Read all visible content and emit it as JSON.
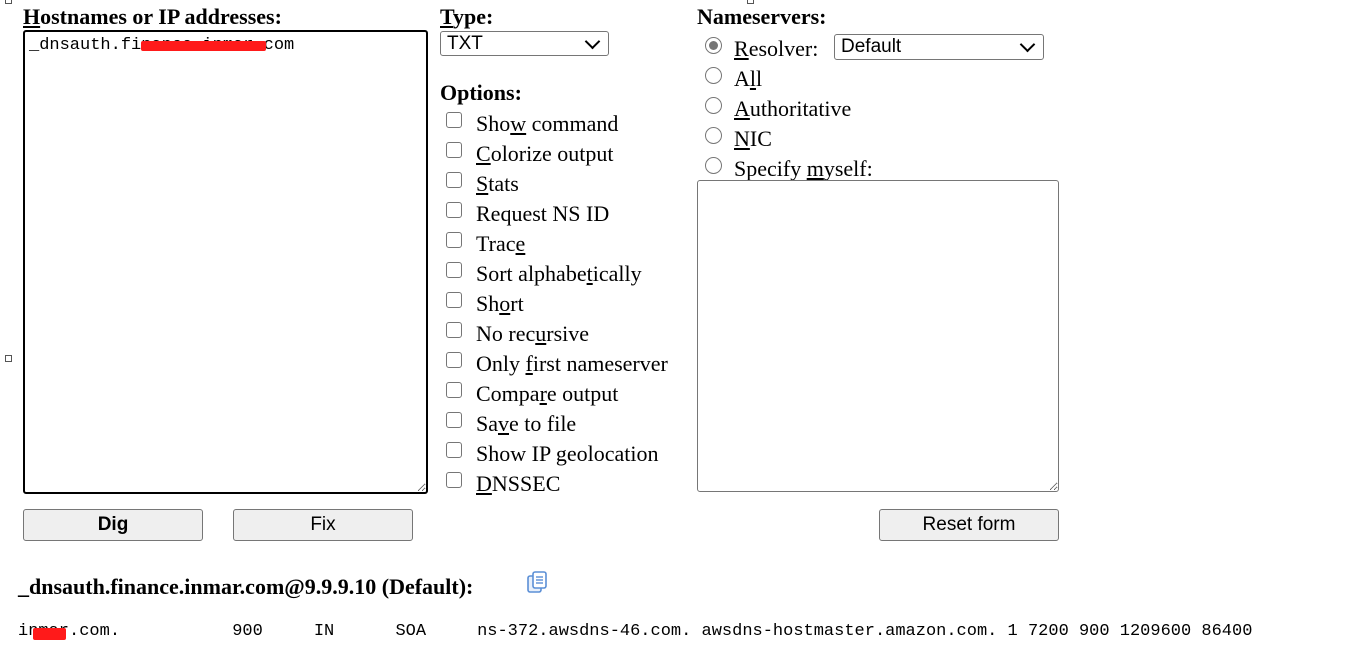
{
  "form": {
    "hostnames_label_first": "H",
    "hostnames_label_rest": "ostnames or IP addresses:",
    "hostnames_value": "_dnsauth.finance.inmar.com",
    "type_label_first": "T",
    "type_label_rest": "ype:",
    "type_value": "TXT",
    "options_label": "Options:",
    "options": [
      {
        "pre": "Sho",
        "key": "w",
        "post": " command"
      },
      {
        "pre": "",
        "key": "C",
        "post": "olorize output"
      },
      {
        "pre": "",
        "key": "S",
        "post": "tats"
      },
      {
        "pre": "Request NS ID",
        "key": "",
        "post": ""
      },
      {
        "pre": "Trac",
        "key": "e",
        "post": ""
      },
      {
        "pre": "Sort alphabe",
        "key": "t",
        "post": "ically"
      },
      {
        "pre": "Sh",
        "key": "o",
        "post": "rt"
      },
      {
        "pre": "No rec",
        "key": "u",
        "post": "rsive"
      },
      {
        "pre": "Only ",
        "key": "f",
        "post": "irst nameserver"
      },
      {
        "pre": "Compa",
        "key": "r",
        "post": "e output"
      },
      {
        "pre": "Sa",
        "key": "v",
        "post": "e to file"
      },
      {
        "pre": "Show IP geolocation",
        "key": "",
        "post": ""
      },
      {
        "pre": "",
        "key": "D",
        "post": "NSSEC"
      }
    ],
    "nameservers_label": "Nameservers:",
    "resolver_pre": "",
    "resolver_key": "R",
    "resolver_post": "esolver:",
    "resolver_value": "Default",
    "ns_all_pre": "A",
    "ns_all_key": "l",
    "ns_all_post": "l",
    "ns_auth_key": "A",
    "ns_auth_post": "uthoritative",
    "ns_nic_key": "N",
    "ns_nic_post": "IC",
    "ns_specify_pre": "Specify ",
    "ns_specify_key": "m",
    "ns_specify_post": "yself:",
    "dig_button": "Dig",
    "fix_button": "Fix",
    "reset_button": "Reset form"
  },
  "result": {
    "title": "_dnsauth.finance.inmar.com@9.9.9.10 (Default):",
    "record": "inmar.com.           900     IN      SOA     ns-372.awsdns-46.com. awsdns-hostmaster.amazon.com. 1 7200 900 1209600 86400"
  },
  "colors": {
    "redaction": "#ff1a1a",
    "copy_icon": "#5b8fd6"
  }
}
